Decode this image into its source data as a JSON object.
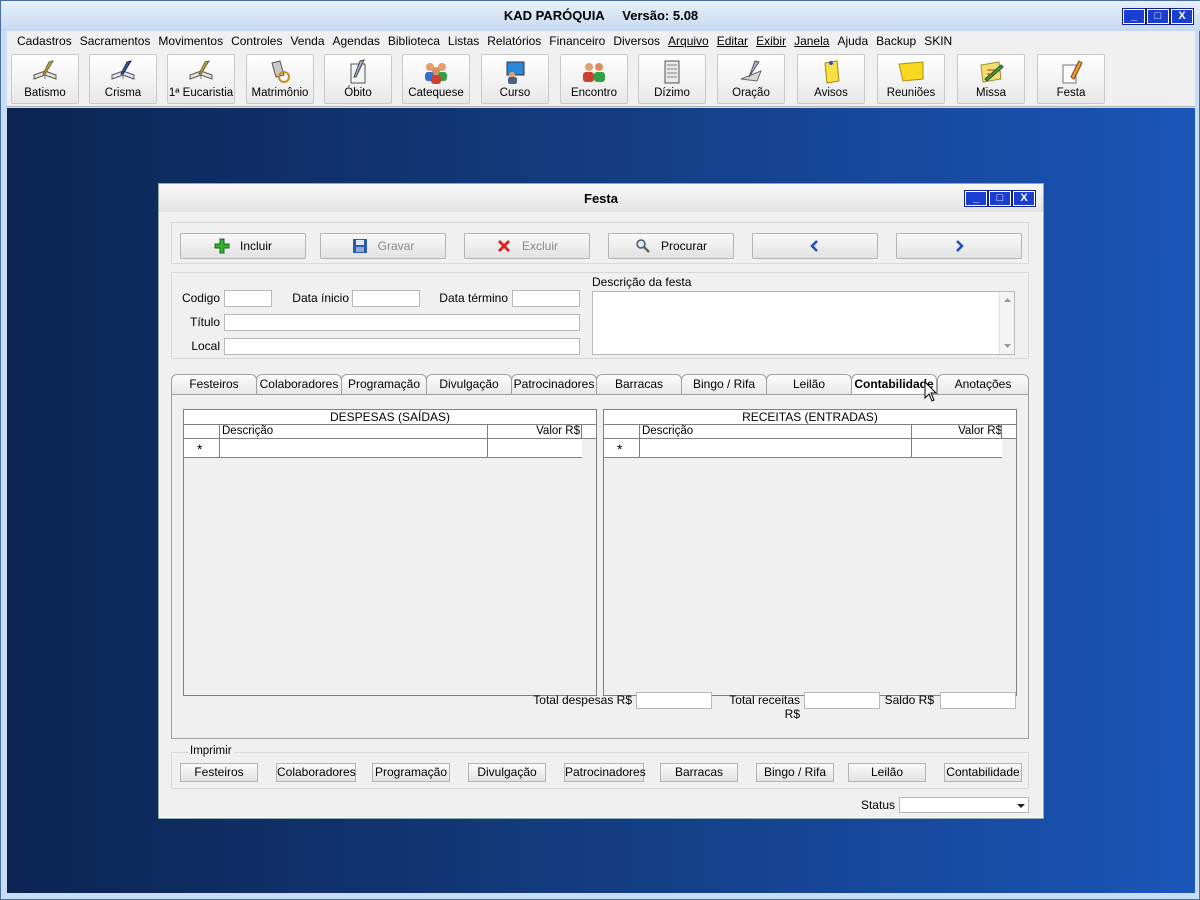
{
  "app": {
    "title": "KAD PARÓQUIA     Versão: 5.08",
    "window_buttons": [
      "_",
      "□",
      "X"
    ]
  },
  "menu": [
    "Cadastros",
    "Sacramentos",
    "Movimentos",
    "Controles",
    "Venda",
    "Agendas",
    "Biblioteca",
    "Listas",
    "Relatórios",
    "Financeiro",
    "Diversos",
    "Arquivo",
    "Editar",
    "Exibir",
    "Janela",
    "Ajuda",
    "Backup",
    "SKIN"
  ],
  "toolbar": [
    {
      "label": "Batismo",
      "icon": "book-pen-icon"
    },
    {
      "label": "Crisma",
      "icon": "book-pen-icon"
    },
    {
      "label": "1ª Eucaristia",
      "icon": "book-pen-icon"
    },
    {
      "label": "Matrimônio",
      "icon": "rings-icon"
    },
    {
      "label": "Óbito",
      "icon": "notepad-icon"
    },
    {
      "label": "Catequese",
      "icon": "group-icon"
    },
    {
      "label": "Curso",
      "icon": "presentation-icon"
    },
    {
      "label": "Encontro",
      "icon": "people-icon"
    },
    {
      "label": "Dízimo",
      "icon": "register-icon"
    },
    {
      "label": "Oração",
      "icon": "feather-icon"
    },
    {
      "label": "Avisos",
      "icon": "note-icon"
    },
    {
      "label": "Reuniões",
      "icon": "sticky-note-icon"
    },
    {
      "label": "Missa",
      "icon": "pencil-note-icon"
    },
    {
      "label": "Festa",
      "icon": "pencil-paper-icon"
    }
  ],
  "festa": {
    "title": "Festa",
    "commands": {
      "incluir": "Incluir",
      "gravar": "Gravar",
      "excluir": "Excluir",
      "procurar": "Procurar"
    },
    "form": {
      "codigo_label": "Codigo",
      "data_inicio_label": "Data ínicio",
      "data_termino_label": "Data término",
      "titulo_label": "Título",
      "local_label": "Local",
      "descricao_label": "Descrição da festa"
    },
    "tabs": [
      "Festeiros",
      "Colaboradores",
      "Programação",
      "Divulgação",
      "Patrocinadores",
      "Barracas",
      "Bingo / Rifa",
      "Leilão",
      "Contabilidade",
      "Anotações"
    ],
    "active_tab": "Contabilidade",
    "despesas": {
      "title": "DESPESAS (SAÍDAS)",
      "col_descricao": "Descrição",
      "col_valor": "Valor R$",
      "new_row_marker": "*"
    },
    "receitas": {
      "title": "RECEITAS (ENTRADAS)",
      "col_descricao": "Descrição",
      "col_valor": "Valor R$",
      "new_row_marker": "*"
    },
    "totals": {
      "total_despesas_label": "Total despesas R$",
      "total_receitas_label": "Total receitas R$",
      "saldo_label": "Saldo R$"
    },
    "imprimir": {
      "legend": "Imprimir",
      "buttons": [
        "Festeiros",
        "Colaboradores",
        "Programação",
        "Divulgação",
        "Patrocinadores",
        "Barracas",
        "Bingo / Rifa",
        "Leilão",
        "Contabilidade"
      ]
    },
    "status_label": "Status"
  }
}
